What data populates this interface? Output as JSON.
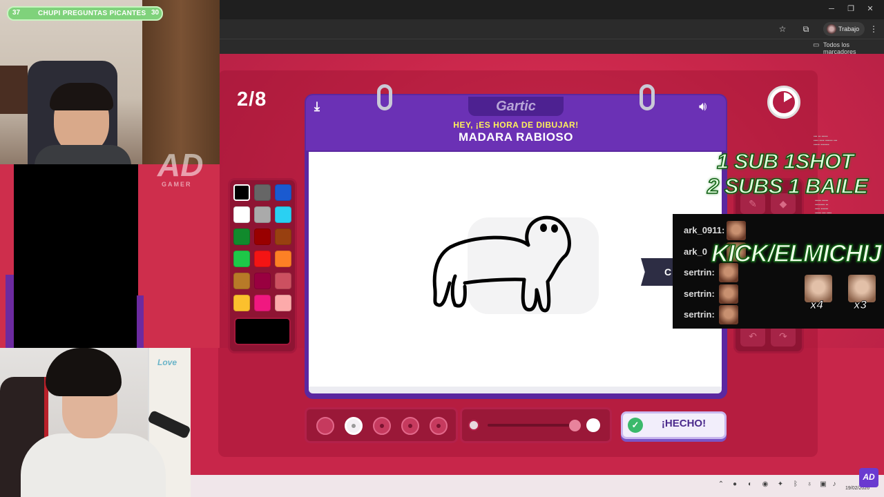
{
  "browser": {
    "window_buttons": {
      "minimize": "─",
      "maximize": "❐",
      "close": "✕"
    },
    "profile_label": "Trabajo",
    "bookmarks_label": "Todos los marcadores"
  },
  "stream": {
    "viewer_bar": {
      "left_count": "37",
      "title": "CHUPI PREGUNTAS PICANTES",
      "right_count": "30"
    },
    "watermark_logo": "AD",
    "watermark_sub": "GAMER",
    "sub_line1": "1 SUB  1SHOT",
    "sub_line2": "2 SUBS 1 BAILE",
    "kick_handle": "KICK/ELMICHIJ",
    "chat": [
      {
        "user": "ark_0911:"
      },
      {
        "user": "ark_0"
      },
      {
        "user": "sertrin:"
      },
      {
        "user": "sertrin:"
      },
      {
        "user": "sertrin:"
      }
    ],
    "emote_counts": [
      "x4",
      "x3"
    ],
    "love_sign": "Love",
    "corner_logo": "AD"
  },
  "game": {
    "round_counter": "2/8",
    "logo": "Gartic",
    "header_line1": "HEY, ¡ES HORA DE DIBUJAR!",
    "header_line2": "MADARA RABIOSO",
    "done_button": "¡HECHO!",
    "stroke_tag": "C",
    "palette_colors": [
      "#000000",
      "#666666",
      "#1a5ad0",
      "#ffffff",
      "#aaaaaa",
      "#2ad0f2",
      "#118a2c",
      "#990000",
      "#984010",
      "#1ec848",
      "#f41414",
      "#fd8025",
      "#b87a28",
      "#990040",
      "#cc5060",
      "#fbc02d",
      "#f01880",
      "#fcaaaa"
    ],
    "selected_color": "#000000",
    "brush_sizes": 5,
    "selected_brush_size": 2
  },
  "taskbar": {
    "date": "19/02/2026"
  }
}
